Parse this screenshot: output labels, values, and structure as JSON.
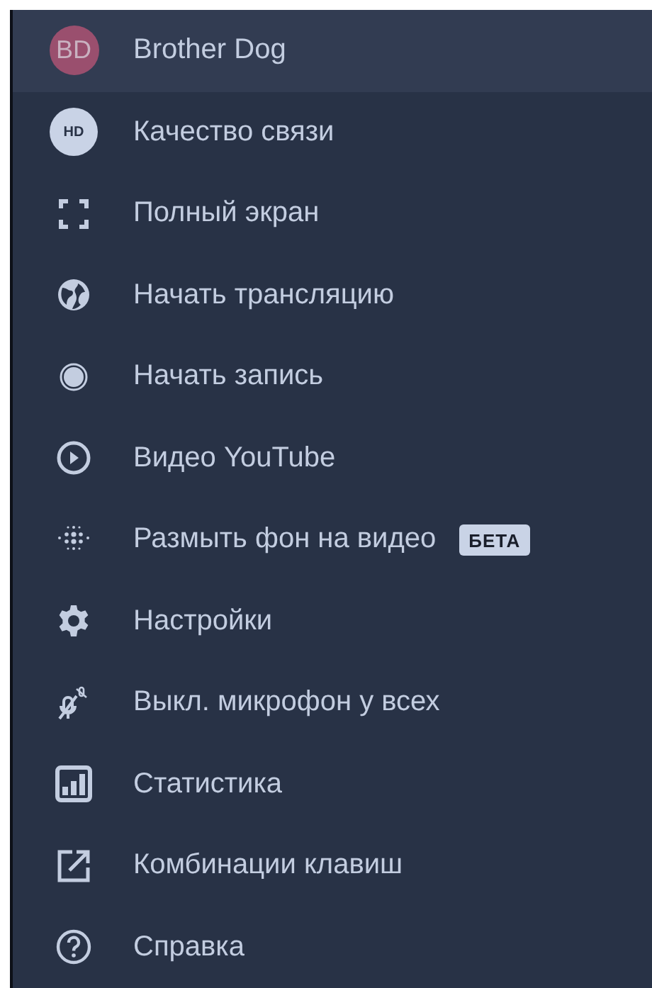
{
  "menu": {
    "items": [
      {
        "kind": "avatar",
        "initials": "BD",
        "color": "#9a4f6e",
        "label": "Brother Dog",
        "selected": true
      },
      {
        "kind": "hd",
        "initials": "HD",
        "label": "Качество связи",
        "selected": false
      },
      {
        "kind": "icon",
        "label": "Полный экран",
        "selected": false
      },
      {
        "kind": "icon",
        "label": "Начать трансляцию",
        "selected": false
      },
      {
        "kind": "icon",
        "label": "Начать запись",
        "selected": false
      },
      {
        "kind": "icon",
        "label": "Видео YouTube",
        "selected": false
      },
      {
        "kind": "icon",
        "label": "Размыть фон на видео",
        "badge": "БЕТА",
        "selected": false
      },
      {
        "kind": "icon",
        "label": "Настройки",
        "selected": false
      },
      {
        "kind": "icon",
        "label": "Выкл. микрофон у всех",
        "selected": false
      },
      {
        "kind": "icon",
        "label": "Статистика",
        "selected": false
      },
      {
        "kind": "icon",
        "label": "Комбинации клавиш",
        "selected": false
      },
      {
        "kind": "icon",
        "label": "Справка",
        "selected": false
      }
    ]
  }
}
